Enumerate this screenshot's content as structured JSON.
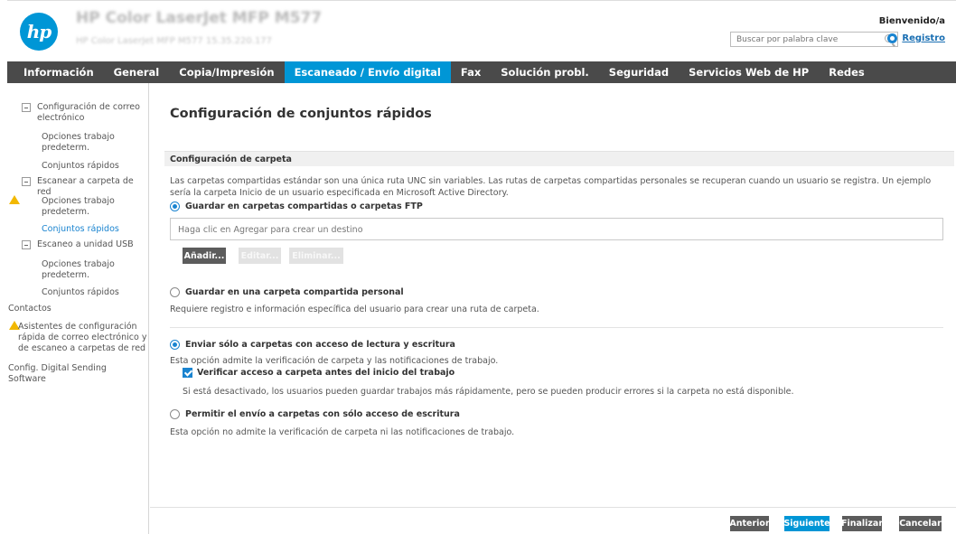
{
  "header": {
    "logo_text": "hp",
    "device_name": "HP Color LaserJet MFP M577",
    "device_subtitle": "HP Color LaserJet MFP M577   15.35.220.177",
    "search_placeholder": "Buscar por palabra clave",
    "welcome": "Bienvenido/a",
    "register": "Registro"
  },
  "nav": {
    "items": [
      "Información",
      "General",
      "Copia/Impresión",
      "Escaneado / Envío digital",
      "Fax",
      "Solución probl.",
      "Seguridad",
      "Servicios Web de HP",
      "Redes"
    ],
    "active_index": 3
  },
  "sidebar": {
    "email_setup": "Configuración de correo electrónico",
    "email_defaults": "Opciones trabajo predeterm.",
    "email_quicksets": "Conjuntos rápidos",
    "scan_folder": "Escanear a carpeta de red",
    "folder_defaults": "Opciones trabajo predeterm.",
    "folder_quicksets": "Conjuntos rápidos",
    "usb_scan": "Escaneo a unidad USB",
    "usb_defaults": "Opciones trabajo predeterm.",
    "usb_quicksets": "Conjuntos rápidos",
    "contacts": "Contactos",
    "wizards": "Asistentes de configuración rápida de correo electrónico y de escaneo a carpetas de red",
    "dss": "Config. Digital Sending Software"
  },
  "main": {
    "title": "Configuración de conjuntos rápidos",
    "section_title": "Configuración de carpeta",
    "intro": "Las carpetas compartidas estándar son una única ruta UNC sin variables. Las rutas de carpetas compartidas personales se recuperan cuando un usuario se registra. Un ejemplo sería la carpeta Inicio de un usuario especificada en Microsoft Active Directory.",
    "option_shared": "Guardar en carpetas compartidas o carpetas FTP",
    "dest_placeholder": "Haga clic en Agregar para crear un destino",
    "btn_add": "Añadir...",
    "btn_edit": "Editar...",
    "btn_delete": "Eliminar...",
    "option_personal": "Guardar en una carpeta compartida personal",
    "personal_desc": "Requiere registro e información específica del usuario para crear una ruta de carpeta.",
    "option_rw": "Enviar sólo a carpetas con acceso de lectura y escritura",
    "rw_desc": "Esta opción admite la verificación de carpeta y las notificaciones de trabajo.",
    "verify_label": "Verificar acceso a carpeta antes del inicio del trabajo",
    "verify_desc": "Si está desactivado, los usuarios pueden guardar trabajos más rápidamente, pero se pueden producir errores si la carpeta no está disponible.",
    "option_wo": "Permitir el envío a carpetas con sólo acceso de escritura",
    "wo_desc": "Esta opción no admite la verificación de carpeta ni las notificaciones de trabajo."
  },
  "footer": {
    "prev": "Anterior",
    "next": "Siguiente",
    "finish": "Finalizar",
    "cancel": "Cancelar"
  },
  "colors": {
    "hp_blue": "#0096d6",
    "nav_bg": "#4a4a4a",
    "warning": "#f2b800"
  }
}
